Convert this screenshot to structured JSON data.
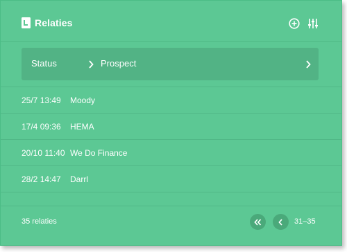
{
  "header": {
    "title": "Relaties",
    "icons": {
      "title": "address-book-icon",
      "add": "plus-circle-icon",
      "filter": "sliders-icon"
    }
  },
  "filter": {
    "key": "Status",
    "value": "Prospect"
  },
  "rows": [
    {
      "time": "25/7 13:49",
      "name": "Moody"
    },
    {
      "time": "17/4 09:36",
      "name": "HEMA"
    },
    {
      "time": "20/10 11:40",
      "name": "We Do Finance"
    },
    {
      "time": "28/2 14:47",
      "name": "Darrl"
    }
  ],
  "footer": {
    "count": "35 relaties",
    "range": "31–35"
  },
  "colors": {
    "background": "#5cc894",
    "filter_bar": "#52b385",
    "button": "#4aa97a",
    "text": "#ffffff"
  }
}
